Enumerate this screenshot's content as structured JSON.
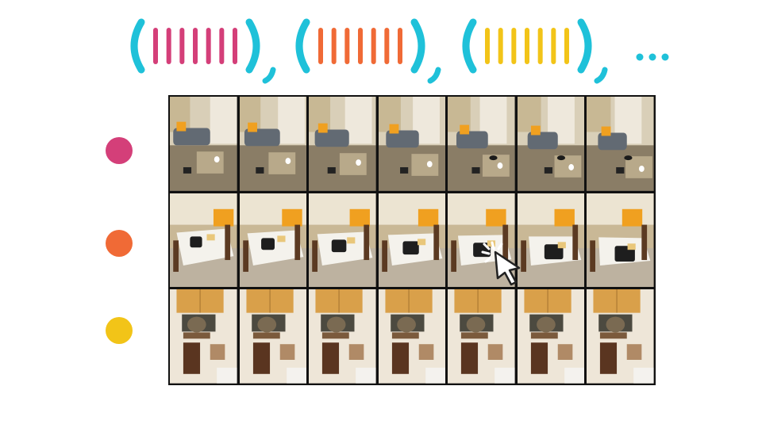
{
  "header": {
    "groups": [
      {
        "name": "token-group-1",
        "color": "#d43f79",
        "token_count": 7
      },
      {
        "name": "token-group-2",
        "color": "#f06a36",
        "token_count": 7
      },
      {
        "name": "token-group-3",
        "color": "#f2c418",
        "token_count": 7
      }
    ],
    "bracket_color": "#1fc1d9",
    "ellipsis": "..."
  },
  "rows": [
    {
      "name": "row-1",
      "color": "#d43f79",
      "scene": "living-room-couch"
    },
    {
      "name": "row-2",
      "color": "#f06a36",
      "scene": "dining-table-clutter"
    },
    {
      "name": "row-3",
      "color": "#f2c418",
      "scene": "kitchen-cabinets"
    }
  ],
  "grid": {
    "columns": 7,
    "rows": 3
  },
  "cursor": {
    "icon": "mouse-pointer-click-icon",
    "row": 2,
    "column": 5
  }
}
